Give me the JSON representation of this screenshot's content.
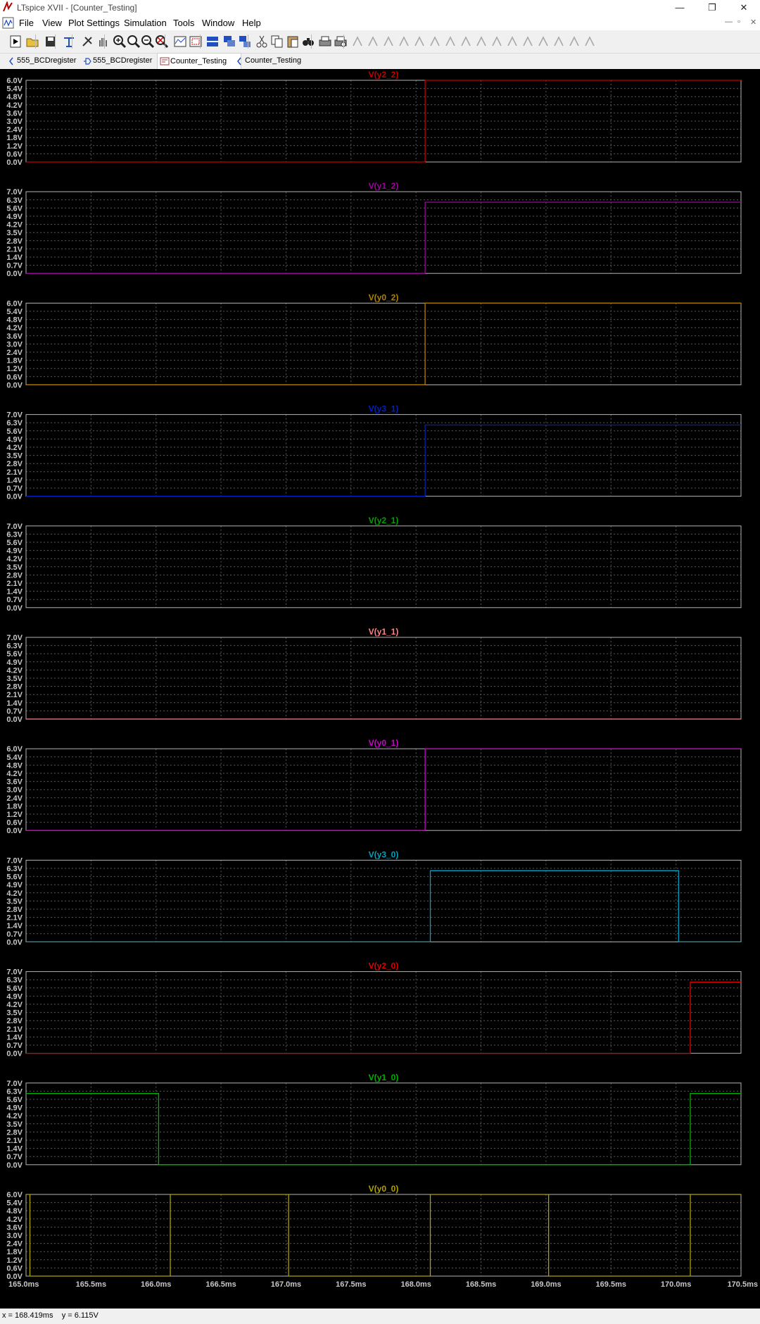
{
  "window": {
    "title": "LTspice XVII - [Counter_Testing]",
    "controls": [
      "—",
      "❐",
      "✕"
    ]
  },
  "menu": {
    "items": [
      "File",
      "View",
      "Plot Settings",
      "Simulation",
      "Tools",
      "Window",
      "Help"
    ],
    "mdi_controls": [
      "—",
      "▫",
      "✕"
    ]
  },
  "toolbar": {
    "icons": [
      "run-icon",
      "open-icon",
      "save-icon",
      "control-panel-icon",
      "halt-icon",
      "pan-hand-icon",
      "zoom-in-icon",
      "zoom-area-icon",
      "zoom-out-icon",
      "zoom-fit-icon",
      "autorange-icon",
      "zoom-full-icon",
      "tile-horizontal-icon",
      "cascade-icon",
      "tile-vertical-icon",
      "cut-icon",
      "copy-icon",
      "paste-icon",
      "find-icon",
      "print-icon",
      "print-preview-icon",
      "draw-wire-icon",
      "ground-icon",
      "label-net-icon",
      "resistor-icon",
      "capacitor-icon",
      "inductor-icon",
      "diode-icon",
      "component-icon",
      "move-icon",
      "drag-icon",
      "undo-icon",
      "redo-icon",
      "rotate-icon",
      "mirror-icon",
      "text-icon",
      "spice-directive-icon"
    ]
  },
  "tabs": [
    {
      "label": "555_BCDregister",
      "icon": "waveform-tab-icon",
      "active": false
    },
    {
      "label": "555_BCDregister",
      "icon": "schematic-tab-icon",
      "active": false
    },
    {
      "label": "Counter_Testing",
      "icon": "schematic-tab-icon",
      "active": true
    },
    {
      "label": "Counter_Testing",
      "icon": "waveform-tab-icon",
      "active": false
    }
  ],
  "chart_data": {
    "type": "line",
    "xlim": [
      165.0,
      170.5
    ],
    "x_unit": "ms",
    "x_ticks": [
      "165.0ms",
      "165.5ms",
      "166.0ms",
      "166.5ms",
      "167.0ms",
      "167.5ms",
      "168.0ms",
      "168.5ms",
      "169.0ms",
      "169.5ms",
      "170.0ms",
      "170.5ms"
    ],
    "grid": true,
    "panes": [
      {
        "name": "V(y2_2)",
        "color": "#c00000",
        "ylim": [
          0,
          6.0
        ],
        "yticks": [
          "6.0V",
          "5.4V",
          "4.8V",
          "4.2V",
          "3.6V",
          "3.0V",
          "2.4V",
          "1.8V",
          "1.2V",
          "0.6V",
          "0.0V"
        ],
        "points": [
          [
            165.0,
            0.0
          ],
          [
            168.07,
            0.0
          ],
          [
            168.07,
            6.0
          ],
          [
            170.5,
            6.0
          ]
        ]
      },
      {
        "name": "V(y1_2)",
        "color": "#a000a0",
        "ylim": [
          0,
          7.0
        ],
        "yticks": [
          "7.0V",
          "6.3V",
          "5.6V",
          "4.9V",
          "4.2V",
          "3.5V",
          "2.8V",
          "2.1V",
          "1.4V",
          "0.7V",
          "0.0V"
        ],
        "points": [
          [
            165.0,
            0.0
          ],
          [
            168.07,
            0.0
          ],
          [
            168.07,
            6.1
          ],
          [
            170.5,
            6.1
          ]
        ]
      },
      {
        "name": "V(y0_2)",
        "color": "#b08000",
        "ylim": [
          0,
          6.0
        ],
        "yticks": [
          "6.0V",
          "5.4V",
          "4.8V",
          "4.2V",
          "3.6V",
          "3.0V",
          "2.4V",
          "1.8V",
          "1.2V",
          "0.6V",
          "0.0V"
        ],
        "points": [
          [
            165.0,
            0.0
          ],
          [
            168.07,
            0.0
          ],
          [
            168.07,
            6.0
          ],
          [
            170.5,
            6.0
          ]
        ]
      },
      {
        "name": "V(y3_1)",
        "color": "#0020c0",
        "ylim": [
          0,
          7.0
        ],
        "yticks": [
          "7.0V",
          "6.3V",
          "5.6V",
          "4.9V",
          "4.2V",
          "3.5V",
          "2.8V",
          "2.1V",
          "1.4V",
          "0.7V",
          "0.0V"
        ],
        "points": [
          [
            165.0,
            0.0
          ],
          [
            168.07,
            0.0
          ],
          [
            168.07,
            6.1
          ],
          [
            170.5,
            6.1
          ]
        ]
      },
      {
        "name": "V(y2_1)",
        "color": "#00a000",
        "ylim": [
          0,
          7.0
        ],
        "yticks": [
          "7.0V",
          "6.3V",
          "5.6V",
          "4.9V",
          "4.2V",
          "3.5V",
          "2.8V",
          "2.1V",
          "1.4V",
          "0.7V",
          "0.0V"
        ],
        "points": []
      },
      {
        "name": "V(y1_1)",
        "color": "#ff8080",
        "ylim": [
          0,
          7.0
        ],
        "yticks": [
          "7.0V",
          "6.3V",
          "5.6V",
          "4.9V",
          "4.2V",
          "3.5V",
          "2.8V",
          "2.1V",
          "1.4V",
          "0.7V",
          "0.0V"
        ],
        "points": [
          [
            165.0,
            0.0
          ],
          [
            170.5,
            0.0
          ]
        ]
      },
      {
        "name": "V(y0_1)",
        "color": "#d000d0",
        "ylim": [
          0,
          6.0
        ],
        "yticks": [
          "6.0V",
          "5.4V",
          "4.8V",
          "4.2V",
          "3.6V",
          "3.0V",
          "2.4V",
          "1.8V",
          "1.2V",
          "0.6V",
          "0.0V"
        ],
        "points": [
          [
            165.0,
            0.0
          ],
          [
            168.07,
            0.0
          ],
          [
            168.07,
            6.0
          ],
          [
            170.5,
            6.0
          ]
        ]
      },
      {
        "name": "V(y3_0)",
        "color": "#00a0c0",
        "ylim": [
          0,
          7.0
        ],
        "yticks": [
          "7.0V",
          "6.3V",
          "5.6V",
          "4.9V",
          "4.2V",
          "3.5V",
          "2.8V",
          "2.1V",
          "1.4V",
          "0.7V",
          "0.0V"
        ],
        "points": [
          [
            165.0,
            0.0
          ],
          [
            168.11,
            0.0
          ],
          [
            168.11,
            6.1
          ],
          [
            170.02,
            6.1
          ],
          [
            170.02,
            0.0
          ],
          [
            170.5,
            0.0
          ]
        ]
      },
      {
        "name": "V(y2_0)",
        "color": "#e00000",
        "ylim": [
          0,
          7.0
        ],
        "yticks": [
          "7.0V",
          "6.3V",
          "5.6V",
          "4.9V",
          "4.2V",
          "3.5V",
          "2.8V",
          "2.1V",
          "1.4V",
          "0.7V",
          "0.0V"
        ],
        "points": [
          [
            165.0,
            0.0
          ],
          [
            170.11,
            0.0
          ],
          [
            170.11,
            6.1
          ],
          [
            170.5,
            6.1
          ]
        ]
      },
      {
        "name": "V(y1_0)",
        "color": "#00b000",
        "ylim": [
          0,
          7.0
        ],
        "yticks": [
          "7.0V",
          "6.3V",
          "5.6V",
          "4.9V",
          "4.2V",
          "3.5V",
          "2.8V",
          "2.1V",
          "1.4V",
          "0.7V",
          "0.0V"
        ],
        "points": [
          [
            165.0,
            6.1
          ],
          [
            166.02,
            6.1
          ],
          [
            166.02,
            0.0
          ],
          [
            170.11,
            0.0
          ],
          [
            170.11,
            6.1
          ],
          [
            170.5,
            6.1
          ]
        ]
      },
      {
        "name": "V(y0_0)",
        "color": "#b0a000",
        "ylim": [
          0,
          6.0
        ],
        "yticks": [
          "6.0V",
          "5.4V",
          "4.8V",
          "4.2V",
          "3.6V",
          "3.0V",
          "2.4V",
          "1.8V",
          "1.2V",
          "0.6V",
          "0.0V"
        ],
        "points": [
          [
            165.0,
            6.0
          ],
          [
            165.03,
            6.0
          ],
          [
            165.03,
            0.0
          ],
          [
            166.11,
            0.0
          ],
          [
            166.11,
            6.0
          ],
          [
            167.02,
            6.0
          ],
          [
            167.02,
            0.0
          ],
          [
            168.11,
            0.0
          ],
          [
            168.11,
            6.0
          ],
          [
            169.02,
            6.0
          ],
          [
            169.02,
            0.0
          ],
          [
            170.11,
            0.0
          ],
          [
            170.11,
            6.0
          ],
          [
            170.5,
            6.0
          ]
        ]
      }
    ]
  },
  "status": {
    "cursor_x": "x = 168.419ms",
    "cursor_y": "y = 6.115V"
  },
  "colors": {
    "background": "#000000",
    "grid": "#5a5a5a",
    "axis_text": "#c8c8c8",
    "pane_border": "#b4b4b4"
  }
}
